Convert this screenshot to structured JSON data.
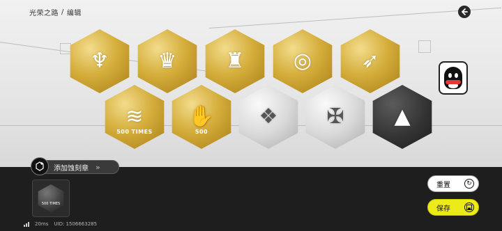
{
  "header": {
    "breadcrumb_root": "光荣之路",
    "breadcrumb_sep": "/",
    "breadcrumb_current": "编辑",
    "back_icon": "back-arrow-icon"
  },
  "badges": [
    {
      "id": "badge-1",
      "material": "gold",
      "icon": "trident-crest-icon",
      "glyph": "♆",
      "caption": ""
    },
    {
      "id": "badge-2",
      "material": "gold",
      "icon": "crown-wreath-icon",
      "glyph": "♛",
      "caption": ""
    },
    {
      "id": "badge-3",
      "material": "gold",
      "icon": "tower-icon",
      "glyph": "♜",
      "caption": ""
    },
    {
      "id": "badge-4",
      "material": "gold",
      "icon": "target-rings-icon",
      "glyph": "◎",
      "caption": ""
    },
    {
      "id": "badge-5",
      "material": "gold",
      "icon": "arrow-triangle-icon",
      "glyph": "➶",
      "caption": ""
    },
    {
      "id": "badge-6",
      "material": "gold",
      "icon": "chevron-stripes-icon",
      "glyph": "≋",
      "caption": "500 TIMES"
    },
    {
      "id": "badge-7",
      "material": "gold",
      "icon": "handshake-icon",
      "glyph": "✋",
      "caption": "500"
    },
    {
      "id": "badge-8",
      "material": "silver",
      "icon": "diamond-emblem-icon",
      "glyph": "❖",
      "caption": ""
    },
    {
      "id": "badge-9",
      "material": "silver",
      "icon": "cross-emblem-icon",
      "glyph": "✠",
      "caption": ""
    },
    {
      "id": "badge-10",
      "material": "dark",
      "icon": "spire-emblem-icon",
      "glyph": "▲",
      "caption": ""
    }
  ],
  "avatar": {
    "icon": "qq-penguin-icon"
  },
  "add_badge": {
    "label": "添加蚀刻章",
    "arrows": "»"
  },
  "slot": {
    "caption": "500 TIMES"
  },
  "status": {
    "ping": "20ms",
    "uid": "UID: 1506663285"
  },
  "buttons": {
    "reset_label": "重置",
    "reset_icon": "refresh-icon",
    "save_label": "保存",
    "save_icon": "save-icon"
  },
  "colors": {
    "gold": "#d4ad3a",
    "silver": "#d9d9d9",
    "dark": "#333333",
    "save_button": "#ecea19",
    "background": "#1e1e1e"
  }
}
